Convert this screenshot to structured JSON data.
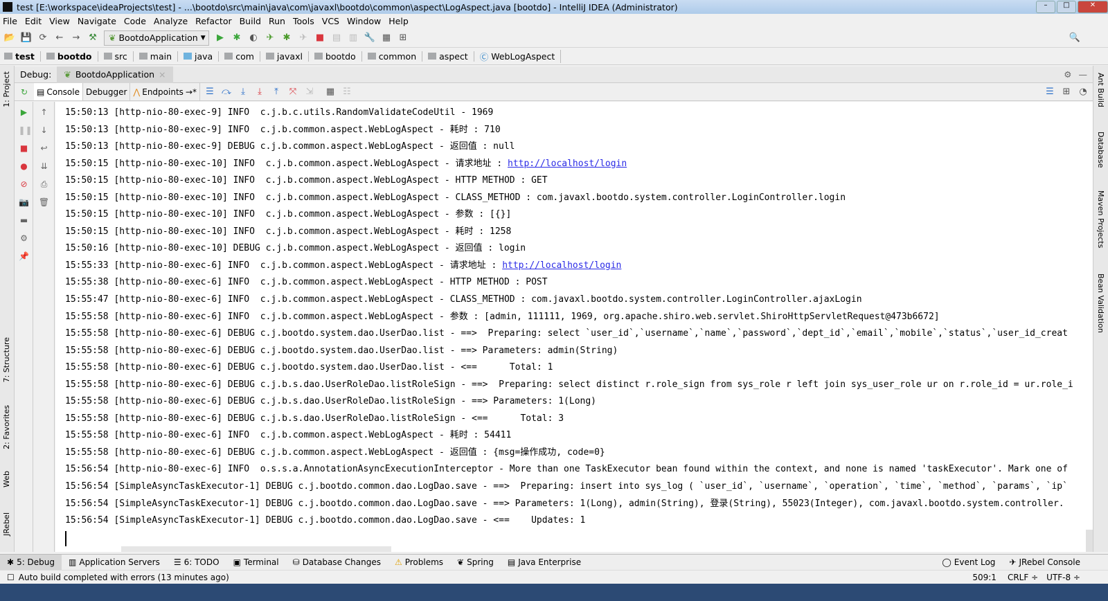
{
  "window": {
    "title": "test [E:\\workspace\\ideaProjects\\test] - ...\\bootdo\\src\\main\\java\\com\\javaxl\\bootdo\\common\\aspect\\LogAspect.java [bootdo] - IntelliJ IDEA (Administrator)",
    "logo": "IJ"
  },
  "menu": [
    "File",
    "Edit",
    "View",
    "Navigate",
    "Code",
    "Analyze",
    "Refactor",
    "Build",
    "Run",
    "Tools",
    "VCS",
    "Window",
    "Help"
  ],
  "toolbar": {
    "run_config": "BootdoApplication"
  },
  "breadcrumbs": [
    {
      "label": "test",
      "bold": true
    },
    {
      "label": "bootdo",
      "bold": true
    },
    {
      "label": "src"
    },
    {
      "label": "main"
    },
    {
      "label": "java",
      "blue": true
    },
    {
      "label": "com"
    },
    {
      "label": "javaxl"
    },
    {
      "label": "bootdo"
    },
    {
      "label": "common"
    },
    {
      "label": "aspect"
    },
    {
      "label": "WebLogAspect",
      "cls": true
    }
  ],
  "debug": {
    "label": "Debug:",
    "tab": "BootdoApplication",
    "subtabs": [
      "Console",
      "Debugger",
      "Endpoints"
    ]
  },
  "left_tools": [
    "1: Project",
    "7: Structure",
    "2: Favorites",
    "Web",
    "JRebel"
  ],
  "right_tools": [
    "Ant Build",
    "Database",
    "Maven Projects",
    "Bean Validation"
  ],
  "console": [
    {
      "text": "15:50:13 [http-nio-80-exec-9] INFO  c.j.b.c.utils.RandomValidateCodeUtil - 1969"
    },
    {
      "text": "15:50:13 [http-nio-80-exec-9] INFO  c.j.b.common.aspect.WebLogAspect - 耗时 : 710"
    },
    {
      "text": "15:50:13 [http-nio-80-exec-9] DEBUG c.j.b.common.aspect.WebLogAspect - 返回值 : null"
    },
    {
      "text": "15:50:15 [http-nio-80-exec-10] INFO  c.j.b.common.aspect.WebLogAspect - 请求地址 : ",
      "link": "http://localhost/login"
    },
    {
      "text": "15:50:15 [http-nio-80-exec-10] INFO  c.j.b.common.aspect.WebLogAspect - HTTP METHOD : GET"
    },
    {
      "text": "15:50:15 [http-nio-80-exec-10] INFO  c.j.b.common.aspect.WebLogAspect - CLASS_METHOD : com.javaxl.bootdo.system.controller.LoginController.login"
    },
    {
      "text": "15:50:15 [http-nio-80-exec-10] INFO  c.j.b.common.aspect.WebLogAspect - 参数 : [{}]"
    },
    {
      "text": "15:50:15 [http-nio-80-exec-10] INFO  c.j.b.common.aspect.WebLogAspect - 耗时 : 1258"
    },
    {
      "text": "15:50:16 [http-nio-80-exec-10] DEBUG c.j.b.common.aspect.WebLogAspect - 返回值 : login"
    },
    {
      "text": "15:55:33 [http-nio-80-exec-6] INFO  c.j.b.common.aspect.WebLogAspect - 请求地址 : ",
      "link": "http://localhost/login"
    },
    {
      "text": "15:55:38 [http-nio-80-exec-6] INFO  c.j.b.common.aspect.WebLogAspect - HTTP METHOD : POST"
    },
    {
      "text": "15:55:47 [http-nio-80-exec-6] INFO  c.j.b.common.aspect.WebLogAspect - CLASS_METHOD : com.javaxl.bootdo.system.controller.LoginController.ajaxLogin"
    },
    {
      "text": "15:55:58 [http-nio-80-exec-6] INFO  c.j.b.common.aspect.WebLogAspect - 参数 : [admin, 111111, 1969, org.apache.shiro.web.servlet.ShiroHttpServletRequest@473b6672]"
    },
    {
      "text": "15:55:58 [http-nio-80-exec-6] DEBUG c.j.bootdo.system.dao.UserDao.list - ==>  Preparing: select `user_id`,`username`,`name`,`password`,`dept_id`,`email`,`mobile`,`status`,`user_id_creat"
    },
    {
      "text": "15:55:58 [http-nio-80-exec-6] DEBUG c.j.bootdo.system.dao.UserDao.list - ==> Parameters: admin(String)"
    },
    {
      "text": "15:55:58 [http-nio-80-exec-6] DEBUG c.j.bootdo.system.dao.UserDao.list - <==      Total: 1"
    },
    {
      "text": "15:55:58 [http-nio-80-exec-6] DEBUG c.j.b.s.dao.UserRoleDao.listRoleSign - ==>  Preparing: select distinct r.role_sign from sys_role r left join sys_user_role ur on r.role_id = ur.role_i"
    },
    {
      "text": "15:55:58 [http-nio-80-exec-6] DEBUG c.j.b.s.dao.UserRoleDao.listRoleSign - ==> Parameters: 1(Long)"
    },
    {
      "text": "15:55:58 [http-nio-80-exec-6] DEBUG c.j.b.s.dao.UserRoleDao.listRoleSign - <==      Total: 3"
    },
    {
      "text": "15:55:58 [http-nio-80-exec-6] INFO  c.j.b.common.aspect.WebLogAspect - 耗时 : 54411"
    },
    {
      "text": "15:55:58 [http-nio-80-exec-6] DEBUG c.j.b.common.aspect.WebLogAspect - 返回值 : {msg=操作成功, code=0}"
    },
    {
      "text": "15:56:54 [http-nio-80-exec-6] INFO  o.s.s.a.AnnotationAsyncExecutionInterceptor - More than one TaskExecutor bean found within the context, and none is named 'taskExecutor'. Mark one of"
    },
    {
      "text": "15:56:54 [SimpleAsyncTaskExecutor-1] DEBUG c.j.bootdo.common.dao.LogDao.save - ==>  Preparing: insert into sys_log ( `user_id`, `username`, `operation`, `time`, `method`, `params`, `ip`"
    },
    {
      "text": "15:56:54 [SimpleAsyncTaskExecutor-1] DEBUG c.j.bootdo.common.dao.LogDao.save - ==> Parameters: 1(Long), admin(String), 登录(String), 55023(Integer), com.javaxl.bootdo.system.controller."
    },
    {
      "text": "15:56:54 [SimpleAsyncTaskExecutor-1] DEBUG c.j.bootdo.common.dao.LogDao.save - <==    Updates: 1"
    }
  ],
  "bottom_tabs": [
    {
      "label": "5: Debug",
      "active": true
    },
    {
      "label": "Application Servers"
    },
    {
      "label": "6: TODO"
    },
    {
      "label": "Terminal"
    },
    {
      "label": "Database Changes"
    },
    {
      "label": "Problems"
    },
    {
      "label": "Spring"
    },
    {
      "label": "Java Enterprise"
    }
  ],
  "bottom_right_tabs": [
    "Event Log",
    "JRebel Console"
  ],
  "status": {
    "message": "Auto build completed with errors (13 minutes ago)",
    "position": "509:1",
    "line_sep": "CRLF ÷",
    "encoding": "UTF-8 ÷"
  }
}
